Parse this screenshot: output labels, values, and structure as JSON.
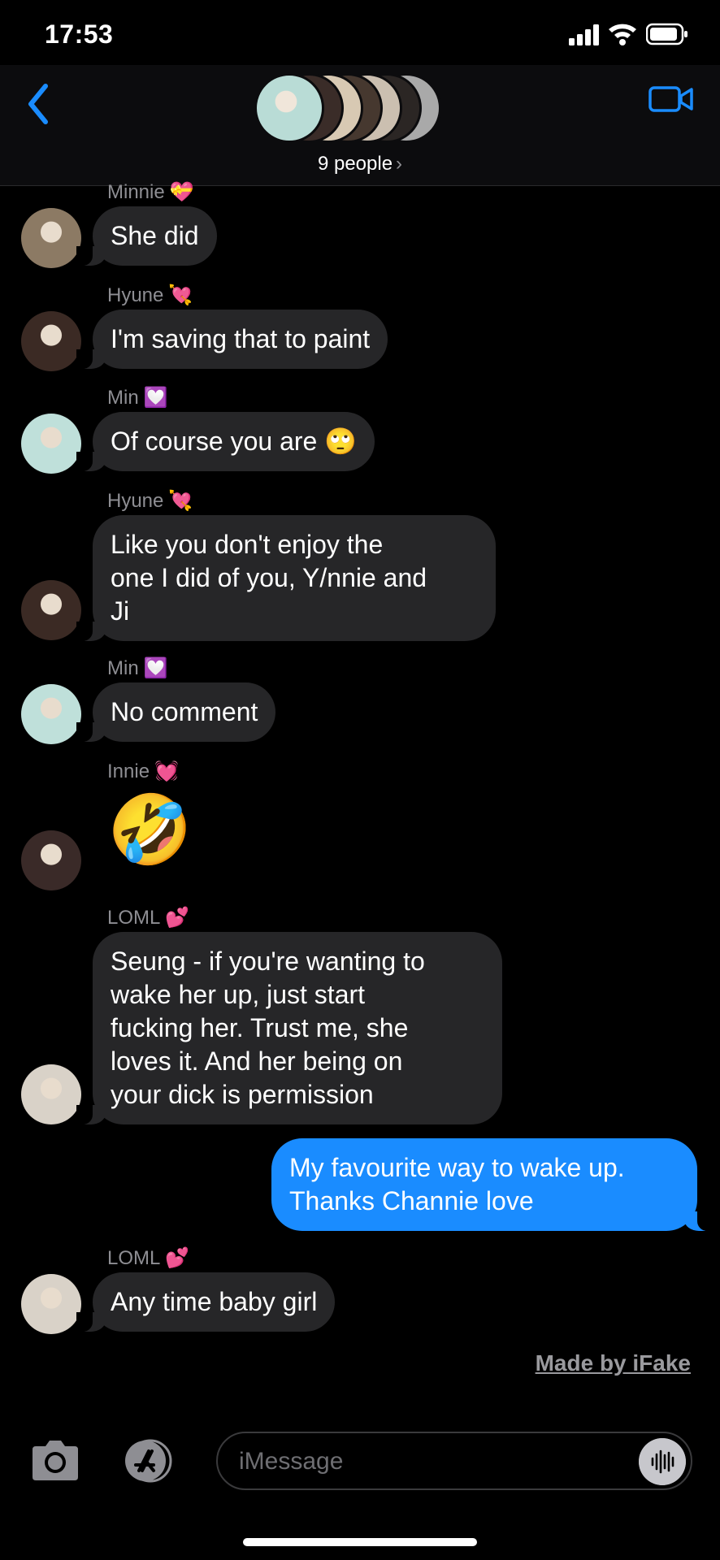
{
  "status_bar": {
    "time": "17:53"
  },
  "header": {
    "group_label": "9 people",
    "chevron": "›",
    "participant_colors": [
      "#b9dcd6",
      "#3a2c28",
      "#d8c9b3",
      "#46382f",
      "#cbbfb0",
      "#2b2624",
      "#a9a9a9"
    ]
  },
  "messages": [
    {
      "sender": "Minnie",
      "sender_emoji": "💝",
      "text": "She did",
      "avatar_color": "#8c7a64"
    },
    {
      "sender": "Hyune",
      "sender_emoji": "💘",
      "text": "I'm saving that to paint",
      "avatar_color": "#3b2a24"
    },
    {
      "sender": "Min",
      "sender_emoji": "💟",
      "text": "Of course you are 🙄",
      "avatar_color": "#bfe0da"
    },
    {
      "sender": "Hyune",
      "sender_emoji": "💘",
      "text_lines": [
        "Like you don't enjoy the",
        "one I did of you, Y/nnie and",
        "Ji"
      ],
      "avatar_color": "#3b2a24"
    },
    {
      "sender": "Min",
      "sender_emoji": "💟",
      "text": "No comment",
      "avatar_color": "#bfe0da"
    },
    {
      "sender": "Innie",
      "sender_emoji": "💓",
      "text": "🤣",
      "avatar_color": "#3a2a28"
    },
    {
      "sender": "LOML",
      "sender_emoji": "💕",
      "text_lines": [
        "Seung - if you're wanting to",
        "wake her up, just start",
        "fucking her. Trust me, she",
        "loves it. And her being on",
        "your dick is permission"
      ],
      "avatar_color": "#d9d2c8"
    },
    {
      "sender": "me",
      "text_lines": [
        "My favourite way to wake up.",
        "Thanks Channie love"
      ]
    },
    {
      "sender": "LOML",
      "sender_emoji": "💕",
      "text": "Any time baby girl",
      "avatar_color": "#d9d2c8"
    }
  ],
  "watermark": "Made by iFake",
  "composer": {
    "placeholder": "iMessage"
  },
  "colors": {
    "bubble_incoming": "#262628",
    "bubble_outgoing": "#1a8cff",
    "accent": "#1a8cff"
  }
}
